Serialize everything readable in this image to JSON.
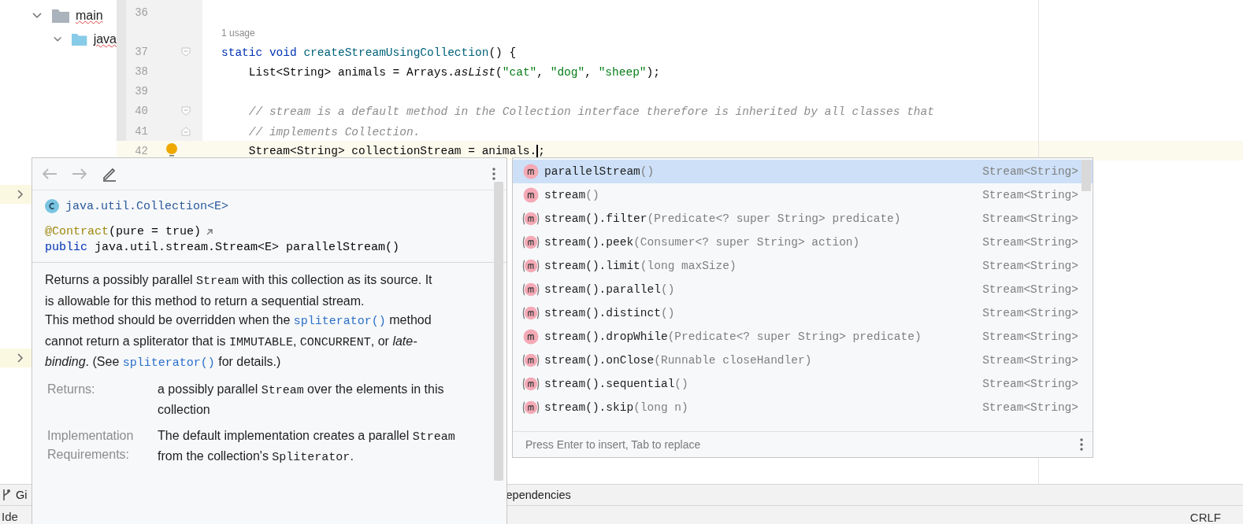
{
  "project_tree": {
    "items": [
      {
        "label": "main",
        "expanded": true,
        "children": [
          {
            "label": "java",
            "expanded": true
          }
        ]
      }
    ]
  },
  "editor": {
    "lines": [
      {
        "kind": "code",
        "number": "36"
      },
      {
        "kind": "hint",
        "text": "1 usage"
      },
      {
        "kind": "code",
        "number": "37",
        "fold_start": true,
        "tokens": [
          {
            "kind": "keyword",
            "text": "static void "
          },
          {
            "kind": "declaration",
            "text": "createStreamUsingCollection"
          },
          {
            "kind": "plain",
            "text": "() {"
          }
        ]
      },
      {
        "kind": "code",
        "number": "38",
        "tokens": [
          {
            "kind": "plain",
            "text": "    List<String> animals = Arrays."
          },
          {
            "kind": "static",
            "text": "asList"
          },
          {
            "kind": "plain",
            "text": "("
          },
          {
            "kind": "string",
            "text": "\"cat\""
          },
          {
            "kind": "plain",
            "text": ", "
          },
          {
            "kind": "string",
            "text": "\"dog\""
          },
          {
            "kind": "plain",
            "text": ", "
          },
          {
            "kind": "string",
            "text": "\"sheep\""
          },
          {
            "kind": "plain",
            "text": ");"
          }
        ]
      },
      {
        "kind": "code",
        "number": "39"
      },
      {
        "kind": "code",
        "number": "40",
        "fold_start": true,
        "tokens": [
          {
            "kind": "comment",
            "text": "    // stream is a default method in the Collection interface therefore is inherited by all classes that"
          }
        ]
      },
      {
        "kind": "code",
        "number": "41",
        "fold_end": true,
        "tokens": [
          {
            "kind": "comment",
            "text": "    // implements Collection."
          }
        ]
      },
      {
        "kind": "code",
        "number": "42",
        "current": true,
        "lightbulb": true,
        "tokens": [
          {
            "kind": "plain",
            "text": "    Stream<String> collectionStream = animals."
          },
          {
            "kind": "caret"
          },
          {
            "kind": "plain",
            "text": ";"
          }
        ]
      }
    ]
  },
  "documentation": {
    "class_ref": "java.util.Collection<E>",
    "annotation": "@Contract",
    "annotation_args": "(pure = true)",
    "signature": [
      {
        "kind": "keyword",
        "text": "public "
      },
      {
        "kind": "plain",
        "text": "java.util.stream.Stream<E> "
      },
      {
        "kind": "bold",
        "text": "parallelStream"
      },
      {
        "kind": "plain",
        "text": "()"
      }
    ],
    "paragraphs": [
      [
        {
          "kind": "text",
          "text": "Returns a possibly parallel "
        },
        {
          "kind": "code",
          "text": "Stream"
        },
        {
          "kind": "text",
          "text": " with this collection as its source. It is allowable for this method to return a sequential stream."
        }
      ],
      [
        {
          "kind": "text",
          "text": "This method should be overridden when the "
        },
        {
          "kind": "link",
          "text": "spliterator()"
        },
        {
          "kind": "text",
          "text": " method cannot return a spliterator that is "
        },
        {
          "kind": "code",
          "text": "IMMUTABLE"
        },
        {
          "kind": "text",
          "text": ", "
        },
        {
          "kind": "code",
          "text": "CONCURRENT"
        },
        {
          "kind": "text",
          "text": ", or "
        },
        {
          "kind": "italic",
          "text": "late-binding"
        },
        {
          "kind": "text",
          "text": ". (See "
        },
        {
          "kind": "link",
          "text": "spliterator()"
        },
        {
          "kind": "text",
          "text": " for details.)"
        }
      ]
    ],
    "sections": [
      {
        "label": "Returns:",
        "segments": [
          {
            "kind": "text",
            "text": "a possibly parallel "
          },
          {
            "kind": "code",
            "text": "Stream"
          },
          {
            "kind": "text",
            "text": " over the elements in this collection"
          }
        ]
      },
      {
        "label": "Implementation Requirements:",
        "segments": [
          {
            "kind": "text",
            "text": "The default implementation creates a parallel "
          },
          {
            "kind": "code",
            "text": "Stream"
          },
          {
            "kind": "text",
            "text": " from the collection's "
          },
          {
            "kind": "code",
            "text": "Spliterator"
          },
          {
            "kind": "text",
            "text": "."
          }
        ]
      }
    ]
  },
  "completion": {
    "items": [
      {
        "kind": "method",
        "name": "parallelStream",
        "params": "()",
        "type": "Stream<String>",
        "selected": true
      },
      {
        "kind": "method",
        "name": "stream",
        "params": "()",
        "type": "Stream<String>",
        "selected": false
      },
      {
        "kind": "chain",
        "name": "stream().filter",
        "params": "(Predicate<? super String> predicate)",
        "type": "Stream<String>",
        "selected": false
      },
      {
        "kind": "chain",
        "name": "stream().peek",
        "params": "(Consumer<? super String> action)",
        "type": "Stream<String>",
        "selected": false
      },
      {
        "kind": "chain",
        "name": "stream().limit",
        "params": "(long maxSize)",
        "type": "Stream<String>",
        "selected": false
      },
      {
        "kind": "chain",
        "name": "stream().parallel",
        "params": "()",
        "type": "Stream<String>",
        "selected": false
      },
      {
        "kind": "chain",
        "name": "stream().distinct",
        "params": "()",
        "type": "Stream<String>",
        "selected": false
      },
      {
        "kind": "method",
        "name": "stream().dropWhile",
        "params": "(Predicate<? super String> predicate)",
        "type": "Stream<String>",
        "selected": false
      },
      {
        "kind": "chain",
        "name": "stream().onClose",
        "params": "(Runnable closeHandler)",
        "type": "Stream<String>",
        "selected": false
      },
      {
        "kind": "chain",
        "name": "stream().sequential",
        "params": "()",
        "type": "Stream<String>",
        "selected": false
      },
      {
        "kind": "chain",
        "name": "stream().skip",
        "params": "(long n)",
        "type": "Stream<String>",
        "selected": false
      }
    ],
    "footer": "Press Enter to insert, Tab to replace"
  },
  "tool_window_bar": {
    "items": [
      {
        "kind": "git",
        "label": "Gi"
      },
      {
        "kind": "plain",
        "label": "ependencies"
      }
    ]
  },
  "status_bar": {
    "left": "Ide",
    "right": "CRLF"
  }
}
